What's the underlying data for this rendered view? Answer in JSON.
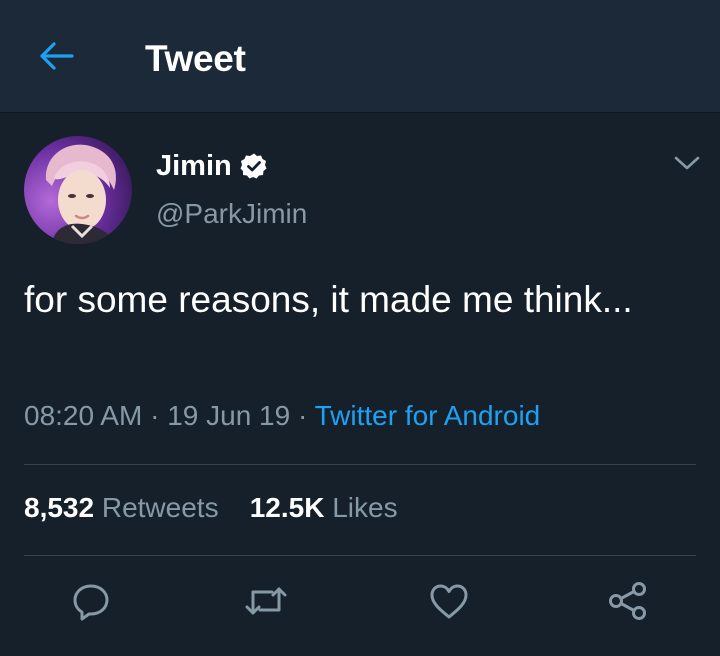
{
  "header": {
    "title": "Tweet",
    "back_icon": "arrow-left-icon",
    "accent": "#1da1f2"
  },
  "tweet": {
    "author": {
      "display_name": "Jimin",
      "handle": "@ParkJimin",
      "verified": true
    },
    "text": "for some reasons, it made me think...",
    "time": "08:20 AM",
    "separator": "·",
    "date": "19 Jun 19",
    "source": "Twitter for Android"
  },
  "stats": {
    "retweets_count": "8,532",
    "retweets_label": "Retweets",
    "likes_count": "12.5K",
    "likes_label": "Likes"
  },
  "actions": [
    "reply-icon",
    "retweet-icon",
    "like-icon",
    "share-icon"
  ],
  "colors": {
    "background": "#15202b",
    "header_bg": "#1c2938",
    "secondary_text": "#8899a6",
    "link": "#1da1f2",
    "divider": "#38444d"
  }
}
